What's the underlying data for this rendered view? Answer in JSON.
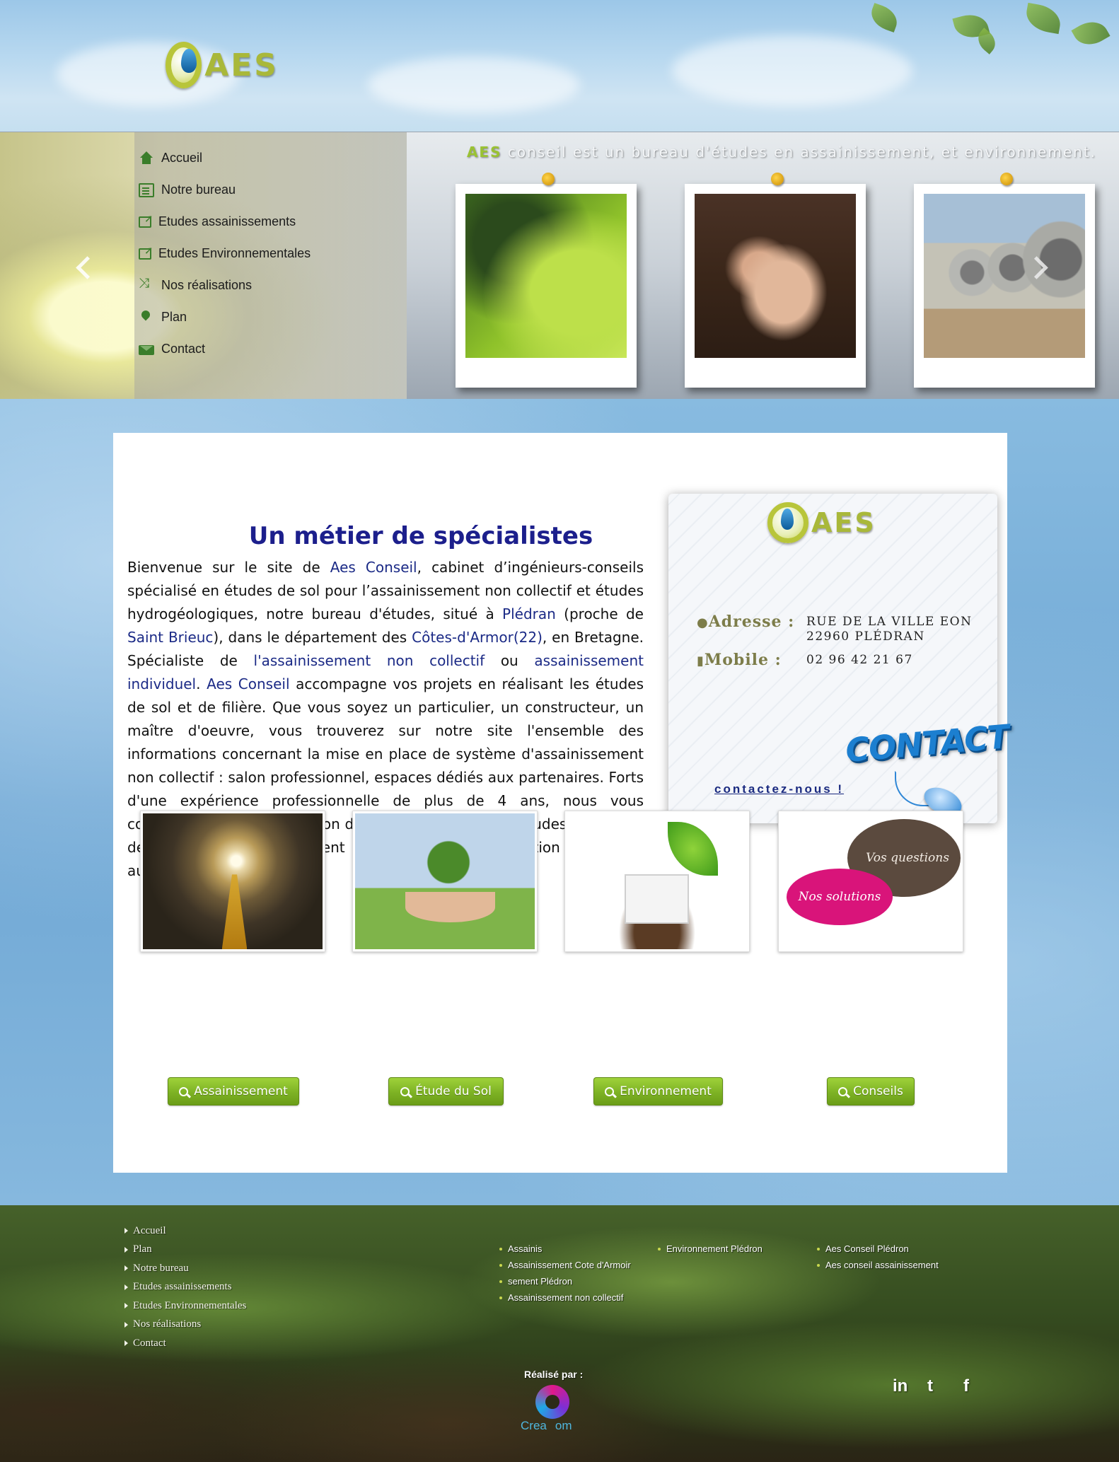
{
  "logo": {
    "text": "AES"
  },
  "nav": {
    "items": [
      {
        "label": "Accueil",
        "icon": "home-icon"
      },
      {
        "label": "Notre bureau",
        "icon": "document-icon"
      },
      {
        "label": "Etudes assainissements",
        "icon": "external-link-icon"
      },
      {
        "label": "Etudes Environnementales",
        "icon": "external-link-icon"
      },
      {
        "label": "Nos réalisations",
        "icon": "shuffle-icon"
      },
      {
        "label": "Plan",
        "icon": "map-marker-icon"
      },
      {
        "label": "Contact",
        "icon": "envelope-icon"
      }
    ]
  },
  "slider": {
    "tagline_brand": "AES",
    "tagline_rest": " conseil est un bureau d'études en assainissement, et  environnement.",
    "prev_icon": "chevron-left-icon",
    "next_icon": "chevron-right-icon"
  },
  "intro": {
    "title": "Un métier de spécialistes",
    "p1": "Bienvenue sur le site de ",
    "l1": "Aes  Conseil",
    "p2": ", cabinet d’ingénieurs-conseils spécialisé en études de sol pour l’assainissement non collectif et études hydrogéologiques, notre bureau d'études, situé à ",
    "l2": "Plédran",
    "p3": " (proche de ",
    "l3": "Saint Brieuc",
    "p4": "), dans le département des ",
    "l4": "Côtes-d'Armor(22)",
    "p5": ", en Bretagne. Spécialiste de ",
    "l5": "l'assainissement non collectif",
    "p6": " ou ",
    "l6": "assainissement individuel",
    "p7": ".  ",
    "l7": "Aes Conseil",
    "p8": " accompagne vos projets en réalisant les études de sol et de filière. Que vous soyez un particulier, un constructeur, un maître d'oeuvre, vous trouverez sur notre site l'ensemble des informations concernant la mise en place de système d'assainissement non collectif : salon professionnel, espaces dédiés aux partenaires. Forts d'une expérience professionnelle de plus de 4 ans, nous vous conseillons dans la réalisation de vos études de sol ou études d'aptitude des sols à l'assainissement non collectif et définition de filière autonome."
  },
  "contact_card": {
    "logo_text": "AES",
    "address_label": "Adresse :",
    "address_line1": "RUE DE LA VILLE EON",
    "address_line2": "22960 PLÉDRAN",
    "mobile_label": "Mobile  :",
    "mobile_value": "02 96 42 21 67",
    "contact_word": "CONTACT",
    "link_text": "contactez-nous !"
  },
  "services": [
    {
      "label": "Assainissement"
    },
    {
      "label": "Étude du Sol"
    },
    {
      "label": "Environnement"
    },
    {
      "label": "Conseils"
    }
  ],
  "bubbles": {
    "questions": "Vos questions",
    "solutions": "Nos solutions"
  },
  "footer": {
    "nav": [
      "Accueil",
      "Plan",
      "Notre bureau",
      "Etudes assainissements",
      "Etudes Environnementales",
      "Nos réalisations",
      "Contact"
    ],
    "col1": [
      "Assainis",
      "Assainissement Cote d'Armoir",
      "sement Plédron",
      "Assainissement non collectif"
    ],
    "col2": [
      "Environnement Plédron"
    ],
    "col3": [
      "Aes Conseil Plédron",
      "Aes conseil assainissement"
    ],
    "realise": "Réalisé par :",
    "creacom_prefix": "Crea",
    "creacom_suffix": "om",
    "social": [
      "linkedin-icon",
      "twitter-icon",
      "facebook-icon"
    ],
    "social_glyphs": [
      "in",
      "t",
      "f"
    ]
  }
}
